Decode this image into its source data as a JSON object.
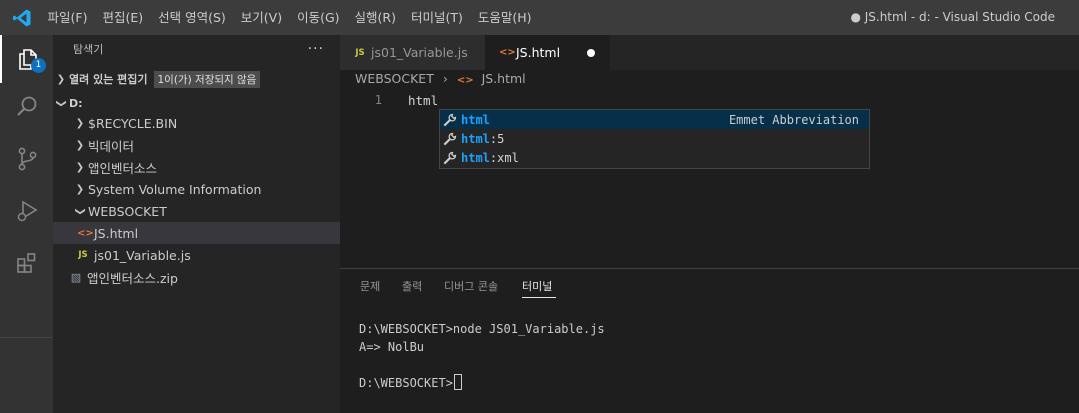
{
  "titlebar": {
    "menu": [
      "파일(F)",
      "편집(E)",
      "선택 영역(S)",
      "보기(V)",
      "이동(G)",
      "실행(R)",
      "터미널(T)",
      "도움말(H)"
    ],
    "window_title": "● JS.html - d: - Visual Studio Code"
  },
  "activitybar": {
    "explorer_badge": "1",
    "items": [
      "files-icon",
      "search-icon",
      "source-control-icon",
      "run-debug-icon",
      "extensions-icon"
    ]
  },
  "sidebar": {
    "title": "탐색기",
    "more": "···",
    "open_editors": {
      "label": "열려 있는 편집기",
      "tag": "1이(가) 저장되지 않음"
    },
    "root": "D:",
    "items": [
      "$RECYCLE.BIN",
      "빅데이터",
      "앱인벤터소스",
      "System Volume Information"
    ],
    "websocket": "WEBSOCKET",
    "ws_files": [
      "JS.html",
      "js01_Variable.js"
    ],
    "zip": "앱인벤터소스.zip",
    "icon_html": "<>",
    "icon_js": "JS"
  },
  "tabs": [
    {
      "label": "js01_Variable.js",
      "icon": "JS"
    },
    {
      "label": "JS.html",
      "icon": "<>"
    }
  ],
  "breadcrumb": {
    "folder": "WEBSOCKET",
    "sep": "›",
    "icon": "<>",
    "file": "JS.html"
  },
  "editor": {
    "line_number": "1",
    "code": "html"
  },
  "suggest": {
    "items": [
      {
        "match": "html",
        "rest": "",
        "detail": "Emmet Abbreviation"
      },
      {
        "match": "html",
        "rest": ":5",
        "detail": ""
      },
      {
        "match": "html",
        "rest": ":xml",
        "detail": ""
      }
    ]
  },
  "panel": {
    "tabs": [
      "문제",
      "출력",
      "디버그 콘솔",
      "터미널"
    ],
    "terminal": {
      "line1": "D:\\WEBSOCKET>node JS01_Variable.js",
      "line2": "A=> NolBu",
      "prompt": "D:\\WEBSOCKET>"
    }
  },
  "colors": {
    "accent": "#0e70c0",
    "html_icon": "#e37933",
    "js_icon": "#cbcb41",
    "match_highlight": "#18a3ff"
  }
}
